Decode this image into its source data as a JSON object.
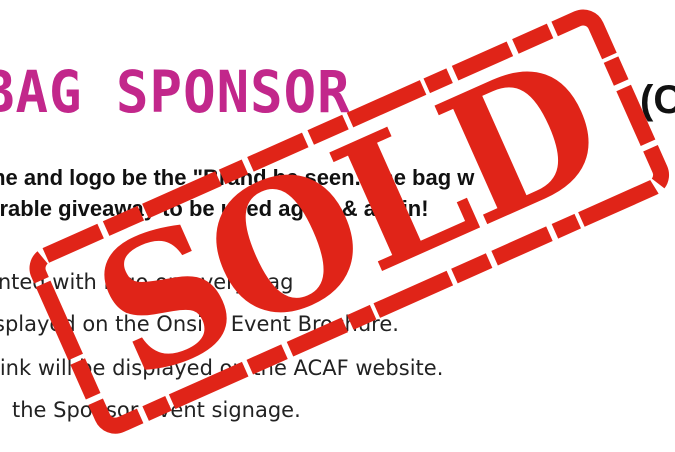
{
  "heading": {
    "title": "BAG SPONSOR",
    "price": "(C"
  },
  "intro": {
    "line1": "me and logo be the \"Brand be seen. The bag w",
    "line2": "orable giveaway to be used again & again!"
  },
  "benefits": [
    "inted with logo on every bag",
    "splayed on the Onsite Event Brochure.",
    "link will be displayed on the ACAF website.",
    "the Sponsor event signage."
  ],
  "stamp": {
    "text": "SOLD",
    "color": "#e02418"
  },
  "colors": {
    "title": "#c2278b",
    "text": "#111111"
  }
}
